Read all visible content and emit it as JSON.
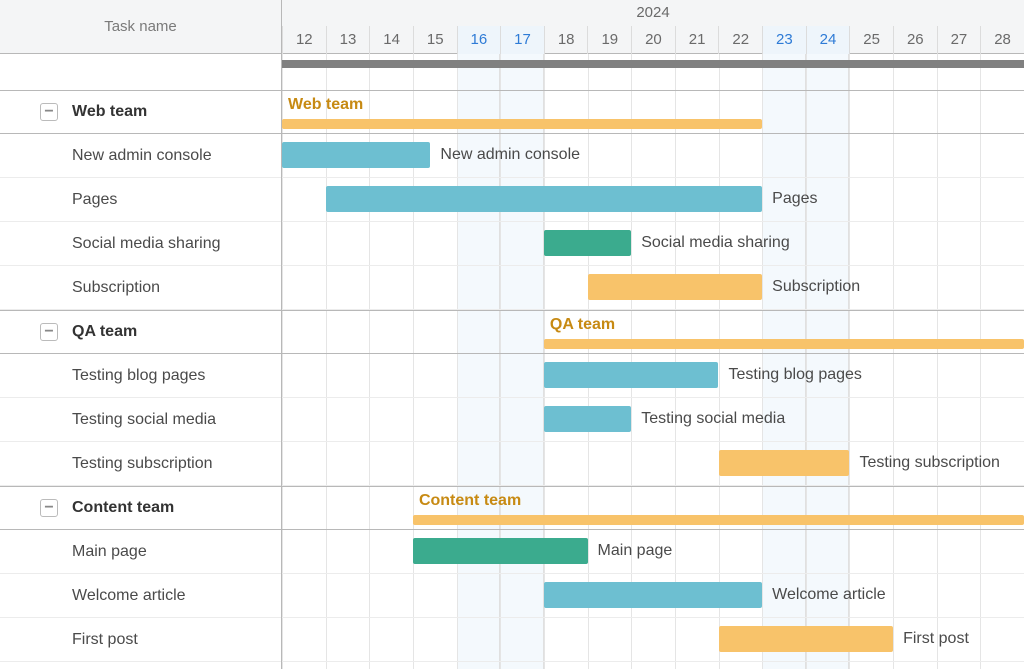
{
  "chart_data": {
    "type": "gantt",
    "year": "2024",
    "day_start": 12,
    "day_end": 28,
    "weekend_days": [
      16,
      17,
      23,
      24
    ],
    "colors": {
      "blue": "#6dbfd1",
      "teal": "#3bab8e",
      "orange": "#f8c36a",
      "group_label": "#c78a13"
    },
    "groups": [
      {
        "name": "Web team",
        "bar_start": 12,
        "bar_end": 23,
        "tasks": [
          {
            "name": "New admin console",
            "start": 12,
            "end": 15.4,
            "color": "blue"
          },
          {
            "name": "Pages",
            "start": 13,
            "end": 23,
            "color": "blue"
          },
          {
            "name": "Social media sharing",
            "start": 18,
            "end": 20,
            "color": "teal"
          },
          {
            "name": "Subscription",
            "start": 19,
            "end": 23,
            "color": "orange"
          }
        ]
      },
      {
        "name": "QA team",
        "bar_start": 18,
        "bar_end": 29,
        "tasks": [
          {
            "name": "Testing blog pages",
            "start": 18,
            "end": 22,
            "color": "blue"
          },
          {
            "name": "Testing social media",
            "start": 18,
            "end": 20,
            "color": "blue"
          },
          {
            "name": "Testing subscription",
            "start": 22,
            "end": 25,
            "color": "orange"
          }
        ]
      },
      {
        "name": "Content team",
        "bar_start": 15,
        "bar_end": 29,
        "tasks": [
          {
            "name": "Main page",
            "start": 15,
            "end": 19,
            "color": "teal"
          },
          {
            "name": "Welcome article",
            "start": 18,
            "end": 23,
            "color": "blue"
          },
          {
            "name": "First post",
            "start": 22,
            "end": 26,
            "color": "orange"
          }
        ]
      }
    ]
  },
  "header": {
    "task_name_label": "Task name"
  }
}
